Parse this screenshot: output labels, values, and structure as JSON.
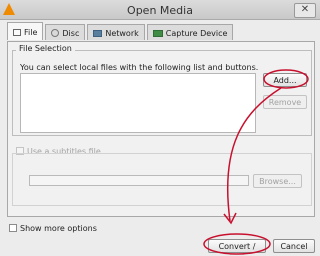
{
  "window": {
    "title": "Open Media",
    "close_glyph": "✕"
  },
  "tabs": [
    {
      "label": "File",
      "icon": "file-icon"
    },
    {
      "label": "Disc",
      "icon": "disc-icon"
    },
    {
      "label": "Network",
      "icon": "network-icon"
    },
    {
      "label": "Capture Device",
      "icon": "capture-device-icon"
    }
  ],
  "file_selection": {
    "title": "File Selection",
    "instruction": "You can select local files with the following list and buttons.",
    "add_label": "Add...",
    "remove_label": "Remove"
  },
  "subtitles": {
    "checkbox_label": "Use a subtitles file",
    "browse_label": "Browse..."
  },
  "footer": {
    "show_more_label": "Show more options",
    "convert_label": "Convert / Save",
    "cancel_label": "Cancel"
  },
  "colors": {
    "annotation": "#c8102e",
    "vlc_orange": "#f08a00"
  }
}
